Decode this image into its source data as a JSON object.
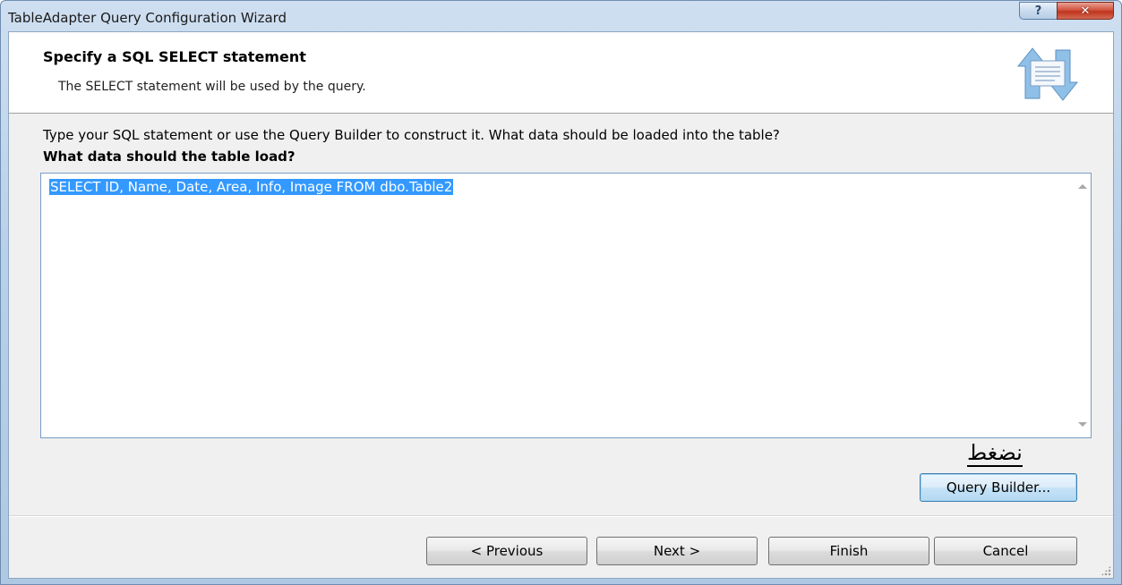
{
  "window": {
    "title": "TableAdapter Query Configuration Wizard",
    "help_glyph": "?",
    "close_glyph": "✕"
  },
  "header": {
    "title": "Specify a SQL SELECT statement",
    "subtitle": "The SELECT statement will be used by the query."
  },
  "body": {
    "instruction": "Type your SQL statement or use the Query Builder to construct it. What data should be loaded into the table?",
    "question": "What data should the table load?",
    "sql_text": "SELECT ID, Name, Date, Area, Info, Image FROM dbo.Table2"
  },
  "annotation": {
    "text": "نضغط"
  },
  "buttons": {
    "query_builder": "Query Builder...",
    "previous": "< Previous",
    "next": "Next >",
    "finish": "Finish",
    "cancel": "Cancel"
  },
  "colors": {
    "selection": "#3399ff",
    "close_button": "#c9462f",
    "accent_border": "#7a9cc6"
  },
  "icons": {
    "wizard_graphic": "database-sync-arrows-icon",
    "help": "help-icon",
    "close": "close-icon",
    "scroll_up": "chevron-up-icon",
    "scroll_down": "chevron-down-icon",
    "resize_grip": "resize-grip-icon"
  }
}
